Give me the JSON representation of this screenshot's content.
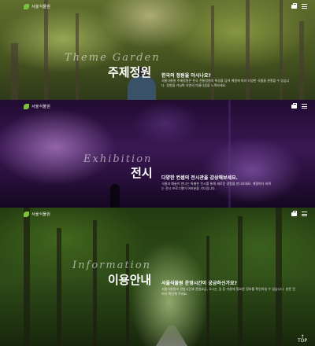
{
  "brand": {
    "name": "서울식물원"
  },
  "icons": {
    "logo": "leaf-icon",
    "cart": "bag-icon",
    "menu": "hamburger-icon",
    "top": "arrow-up-icon"
  },
  "sections": [
    {
      "id": "theme",
      "en": "Theme Garden",
      "ko": "주제정원",
      "intro": "한국의 정원을 아시나요?",
      "desc": "서울식물원 주제정원은 한국 전통정원의 특징을 담아 계절에 따라 다양한 식물을 관찰할 수 있습니다. 정원을 거닐며 자연의 아름다움을 느껴보세요."
    },
    {
      "id": "exhibition",
      "en": "Exhibition",
      "ko": "전시",
      "intro": "다양한 컨셉의 전시관을 감상해보세요.",
      "desc": "식물과 예술이 만나는 특별한 전시를 통해 새로운 경험을 만나보세요. 계절마다 바뀌는 전시 프로그램이 여러분을 기다립니다."
    },
    {
      "id": "information",
      "en": "Information",
      "ko": "이용안내",
      "intro": "서울식물원 운영시간이 궁금하신가요?",
      "desc": "서울식물원의 관람시간과 관람요금, 오시는 길 등 이용에 필요한 정보를 확인하실 수 있습니다. 방문 전 미리 확인해 주세요."
    }
  ],
  "top_button": "TOP"
}
